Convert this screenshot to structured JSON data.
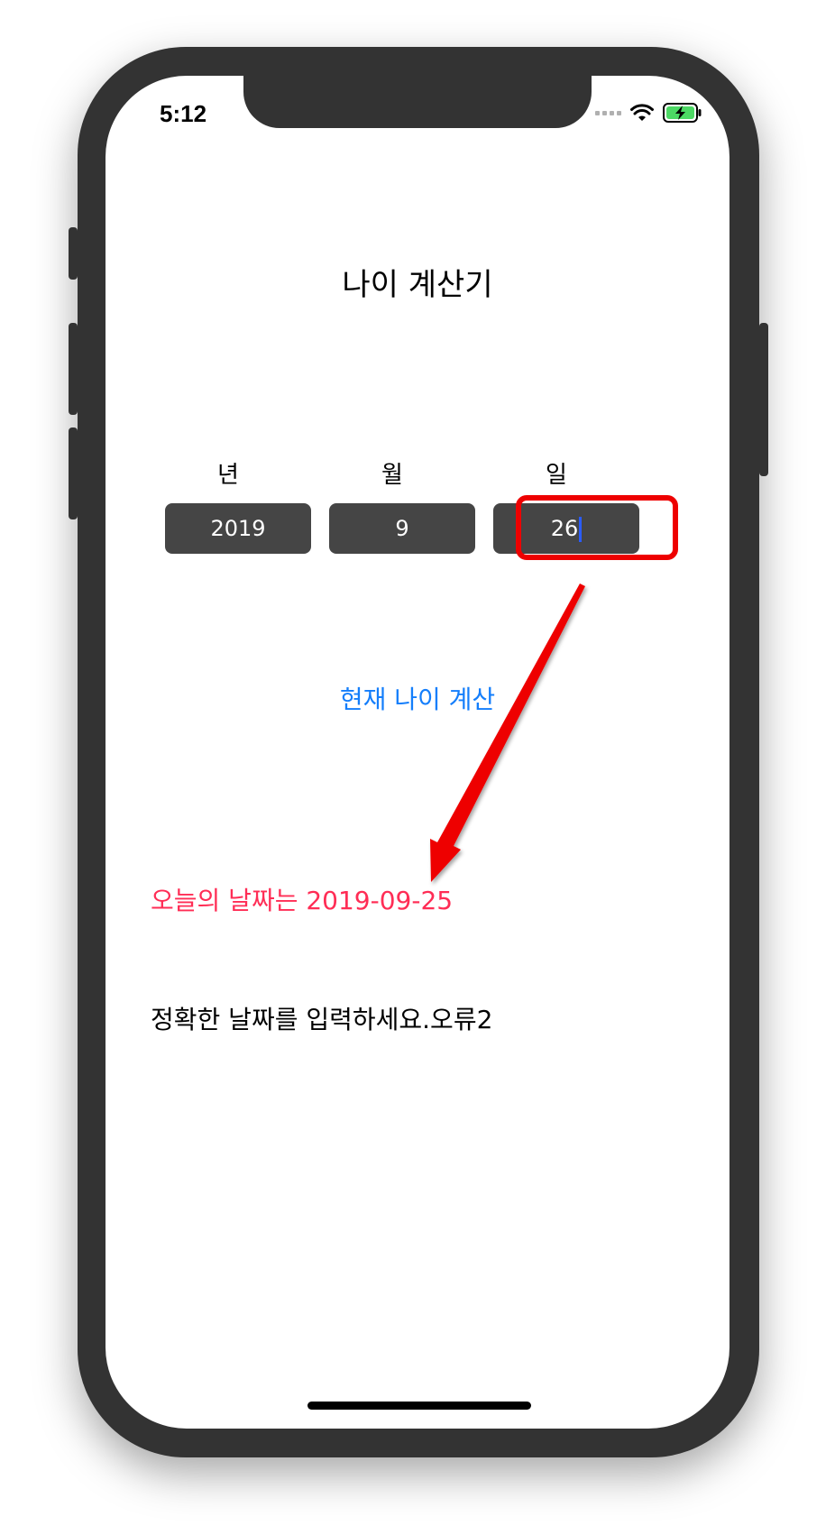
{
  "status_bar": {
    "time": "5:12",
    "icons": [
      "signal-icon",
      "wifi-icon",
      "battery-charging-icon"
    ]
  },
  "app": {
    "title": "나이 계산기",
    "labels": {
      "year": "년",
      "month": "월",
      "day": "일"
    },
    "fields": {
      "year": "2019",
      "month": "9",
      "day": "26"
    },
    "calculate_button": "현재 나이 계산",
    "today_text": "오늘의 날짜는 2019-09-25",
    "message_text": "정확한 날짜를 입력하세요.오류2"
  },
  "colors": {
    "accent_blue": "#147efb",
    "today_red": "#ff2d55",
    "annotation_red": "#ee0000",
    "field_bg": "#454545",
    "phone_body": "#333333"
  }
}
